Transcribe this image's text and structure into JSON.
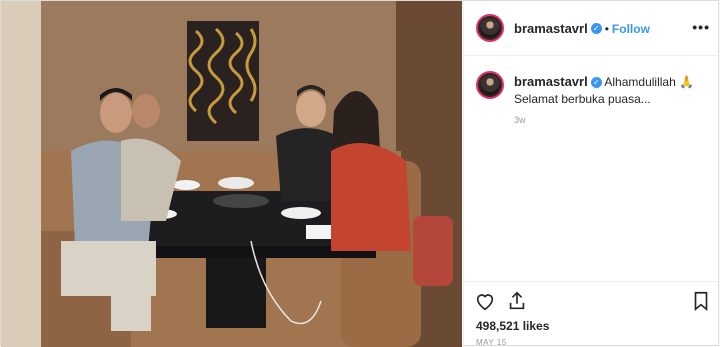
{
  "post": {
    "username": "bramastavrl",
    "follow_label": "Follow",
    "separator": "•",
    "more_label": "•••",
    "verified_mark": "✓",
    "caption_user": "bramastavrl",
    "caption_text_line1": "Alhamdulillah 🙏",
    "caption_text_line2": "Selamat berbuka puasa...",
    "time_ago": "3w",
    "likes": "498,521 likes",
    "date": "MAY 15"
  },
  "icons": {
    "like": "heart-icon",
    "share": "share-icon",
    "save": "bookmark-icon",
    "more": "more-icon",
    "verified": "verified-badge-icon"
  },
  "colors": {
    "accent": "#3897f0",
    "avatar_ring": "#e0306f",
    "text": "#262626",
    "muted": "#999999"
  }
}
